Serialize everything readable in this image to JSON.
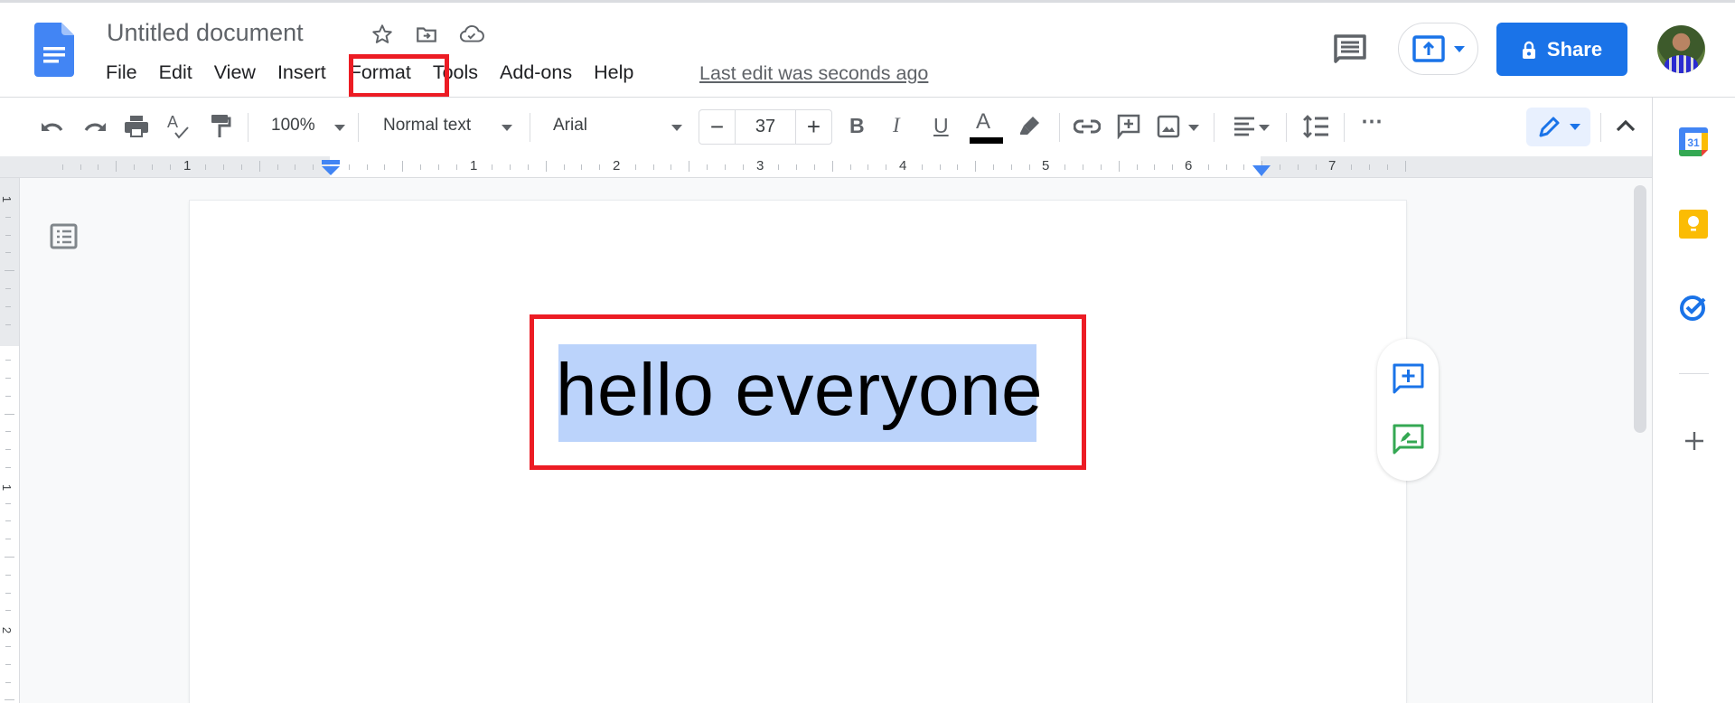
{
  "app": {
    "title": "Untitled document",
    "title_icons": [
      "star-icon",
      "move-to-folder-icon",
      "cloud-saved-icon"
    ],
    "menu": [
      "File",
      "Edit",
      "View",
      "Insert",
      "Format",
      "Tools",
      "Add-ons",
      "Help"
    ],
    "highlighted_menu": "Format",
    "last_edit": "Last edit was seconds ago"
  },
  "header_right": {
    "comments_icon": "comment-history-icon",
    "present_icon": "present-icon",
    "share_label": "Share",
    "share_icon": "lock-icon",
    "avatar": "user-avatar"
  },
  "toolbar": {
    "zoom": "100%",
    "style": "Normal text",
    "font": "Arial",
    "font_size": "37",
    "minus": "−",
    "plus": "+",
    "bold": "B",
    "italic": "I",
    "underline": "U",
    "text_color": "A",
    "text_color_value": "#000000",
    "more": "⋯"
  },
  "ruler": {
    "labels": [
      "1",
      "1",
      "2",
      "3",
      "4",
      "5",
      "6",
      "7"
    ],
    "vertical_labels": [
      "1",
      "1",
      "2"
    ]
  },
  "document": {
    "text": "hello everyone",
    "selected": true
  },
  "colors": {
    "accent": "#1a73e8",
    "annotation_red": "#ec1c24",
    "selection": "#bbd3fb"
  }
}
